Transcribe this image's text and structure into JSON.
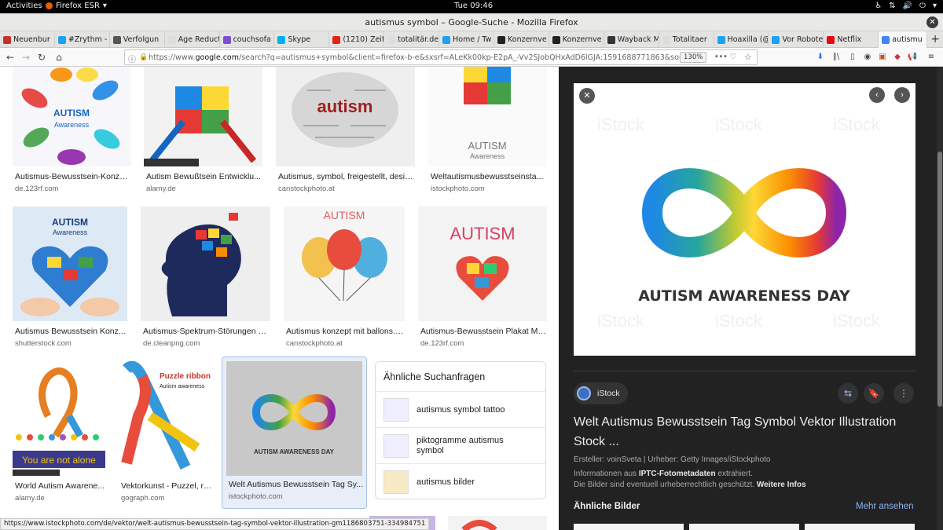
{
  "gnome": {
    "activities": "Activities",
    "app": "Firefox ESR",
    "clock": "Tue 09:46"
  },
  "window": {
    "title": "autismus symbol – Google-Suche - Mozilla Firefox"
  },
  "tabs": [
    {
      "label": "Neuenbur",
      "icon": "z-icon",
      "color": "#c9302c"
    },
    {
      "label": "#Zrythm -",
      "icon": "twitter-icon",
      "color": "#1da1f2"
    },
    {
      "label": "Verfolgun",
      "icon": "w-icon",
      "color": "#555555"
    },
    {
      "label": "Age Reductio",
      "icon": "blank-icon",
      "color": "#dddddd"
    },
    {
      "label": "couchsofa",
      "icon": "m-icon",
      "color": "#7b4fd0"
    },
    {
      "label": "Skype",
      "icon": "skype-icon",
      "color": "#00aff0"
    },
    {
      "label": "(1210) Zeit",
      "icon": "youtube-icon",
      "color": "#e62117"
    },
    {
      "label": "totalitär.de",
      "icon": "blank-icon",
      "color": "#dddddd"
    },
    {
      "label": "Home / Tw",
      "icon": "twitter-icon",
      "color": "#1da1f2"
    },
    {
      "label": "Konzernve",
      "icon": "page-icon",
      "color": "#222222"
    },
    {
      "label": "Konzernve",
      "icon": "page-icon",
      "color": "#222222"
    },
    {
      "label": "Wayback M",
      "icon": "wayback-icon",
      "color": "#333333"
    },
    {
      "label": "Totalitaer",
      "icon": "blank-icon",
      "color": "#dddddd"
    },
    {
      "label": "Hoaxilla (@",
      "icon": "twitter-icon",
      "color": "#1da1f2"
    },
    {
      "label": "Vor Robote",
      "icon": "twitter-icon",
      "color": "#1da1f2"
    },
    {
      "label": "Netflix",
      "icon": "netflix-icon",
      "color": "#e50914"
    },
    {
      "label": "autismu",
      "icon": "google-icon",
      "color": "#4285f4",
      "active": true
    }
  ],
  "nav": {
    "url_prefix": "https://www.",
    "url_host": "google.com",
    "url_rest": "/search?q=autismus+symbol&client=firefox-b-e&sxsrf=ALeKk00kp-E2pA_-Vv2SJobQHxAdD6lGJA:1591688771863&source=lnms&t",
    "zoom": "130%",
    "more": "•••"
  },
  "results": [
    {
      "title": "Autismus-Bewusstsein-Konze...",
      "source": "de.123rf.com",
      "bg": "#f7f7fb"
    },
    {
      "title": "Autism Bewußtsein Entwicklu...",
      "source": "alamy.de",
      "bg": "#f2f2f2"
    },
    {
      "title": "Autismus, symbol, freigestellt, desig...",
      "source": "canstockphoto.at",
      "bg": "#efefef"
    },
    {
      "title": "Weltautismusbewusstseinsta...",
      "source": "istockphoto.com",
      "bg": "#fafafa"
    },
    {
      "title": "Autismus Bewusstsein Konz...",
      "source": "shutterstock.com",
      "bg": "#dde9f5"
    },
    {
      "title": "Autismus-Spektrum-Störungen K...",
      "source": "de.cleanpng.com",
      "bg": "#eeeeee"
    },
    {
      "title": "Autismus konzept mit ballons. ...",
      "source": "canstockphoto.at",
      "bg": "#f5f5f5"
    },
    {
      "title": "Autismus-Bewusstsein Plakat Mi...",
      "source": "de.123rf.com",
      "bg": "#f3f3f3"
    },
    {
      "title": "World Autism Awarene...",
      "source": "alamy.de",
      "bg": "#ffffff"
    },
    {
      "title": "Vektorkunst - Puzzel, ri...",
      "source": "gograph.com",
      "bg": "#ffffff"
    },
    {
      "title": "Welt Autismus Bewusstsein Tag Sy...",
      "source": "istockphoto.com",
      "bg": "#c8c8c8"
    }
  ],
  "thumb_text": {
    "autism": "AUTISM",
    "awareness": "Awareness",
    "autism_word": "autism",
    "autism_title": "AUTISM",
    "awareness_day": "AUTISM AWARENESS DAY",
    "puzzle_ribbon": "Puzzle ribbon",
    "autism_awareness": "Autism awareness",
    "not_alone": "You are not alone"
  },
  "related": {
    "header": "Ähnliche Suchanfragen",
    "items": [
      {
        "label": "autismus symbol tattoo"
      },
      {
        "label": "piktogramme autismus symbol"
      },
      {
        "label": "autismus bilder"
      }
    ]
  },
  "status_url": "https://www.istockphoto.com/de/vektor/welt-autismus-bewusstsein-tag-symbol-vektor-illustration-gm1186803751-334984751",
  "preview": {
    "image_caption": "AUTISM AWARENESS DAY",
    "watermark": "iStock",
    "source": "iStock",
    "title": "Welt Autismus Bewusstsein Tag Symbol Vektor Illustration Stock ...",
    "credit": "Ersteller: voinSveta | Urheber: Getty Images/iStockphoto",
    "info_prefix": "Informationen aus ",
    "info_bold": "IPTC-Fotometadaten",
    "info_suffix": " extrahiert.",
    "copyright": "Die Bilder sind eventuell urheberrechtlich geschützt. ",
    "more_info": "Weitere Infos",
    "similar": "Ähnliche Bilder",
    "see_more": "Mehr ansehen"
  }
}
